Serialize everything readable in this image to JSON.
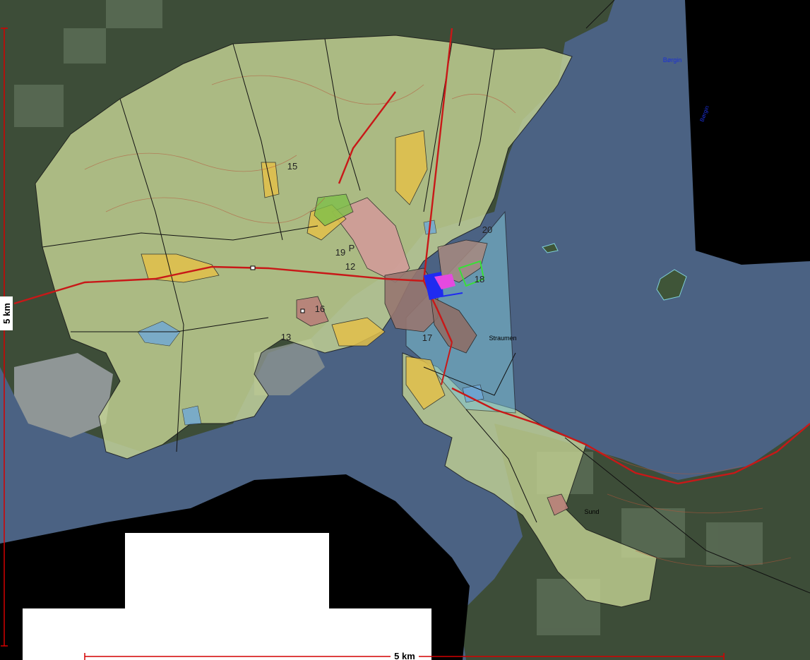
{
  "scale": {
    "horizontal_label": "5 km",
    "vertical_label": "5 km",
    "color": "#d40000"
  },
  "places": {
    "borgin_1": "Børgin",
    "borgin_2": "Børgin",
    "straumen": "Straumen",
    "sund": "Sund"
  },
  "zones": {
    "z12": "12",
    "z13": "13",
    "z15": "15",
    "z16": "16",
    "z17": "17",
    "z18": "18",
    "z19": "19",
    "z20": "20",
    "p": "P"
  },
  "colors": {
    "water": "#4a6280",
    "land_dark": "#40513c",
    "plan_area": "#c9d79a",
    "residential": "#d9a0a0",
    "center": "#9a7a72",
    "yellow_zone": "#e4c24a",
    "water_plan": "#7fbfd0",
    "road": "#cc1a1a",
    "mask": "#000000",
    "blank": "#ffffff",
    "label_blue": "#1a2fd6"
  }
}
